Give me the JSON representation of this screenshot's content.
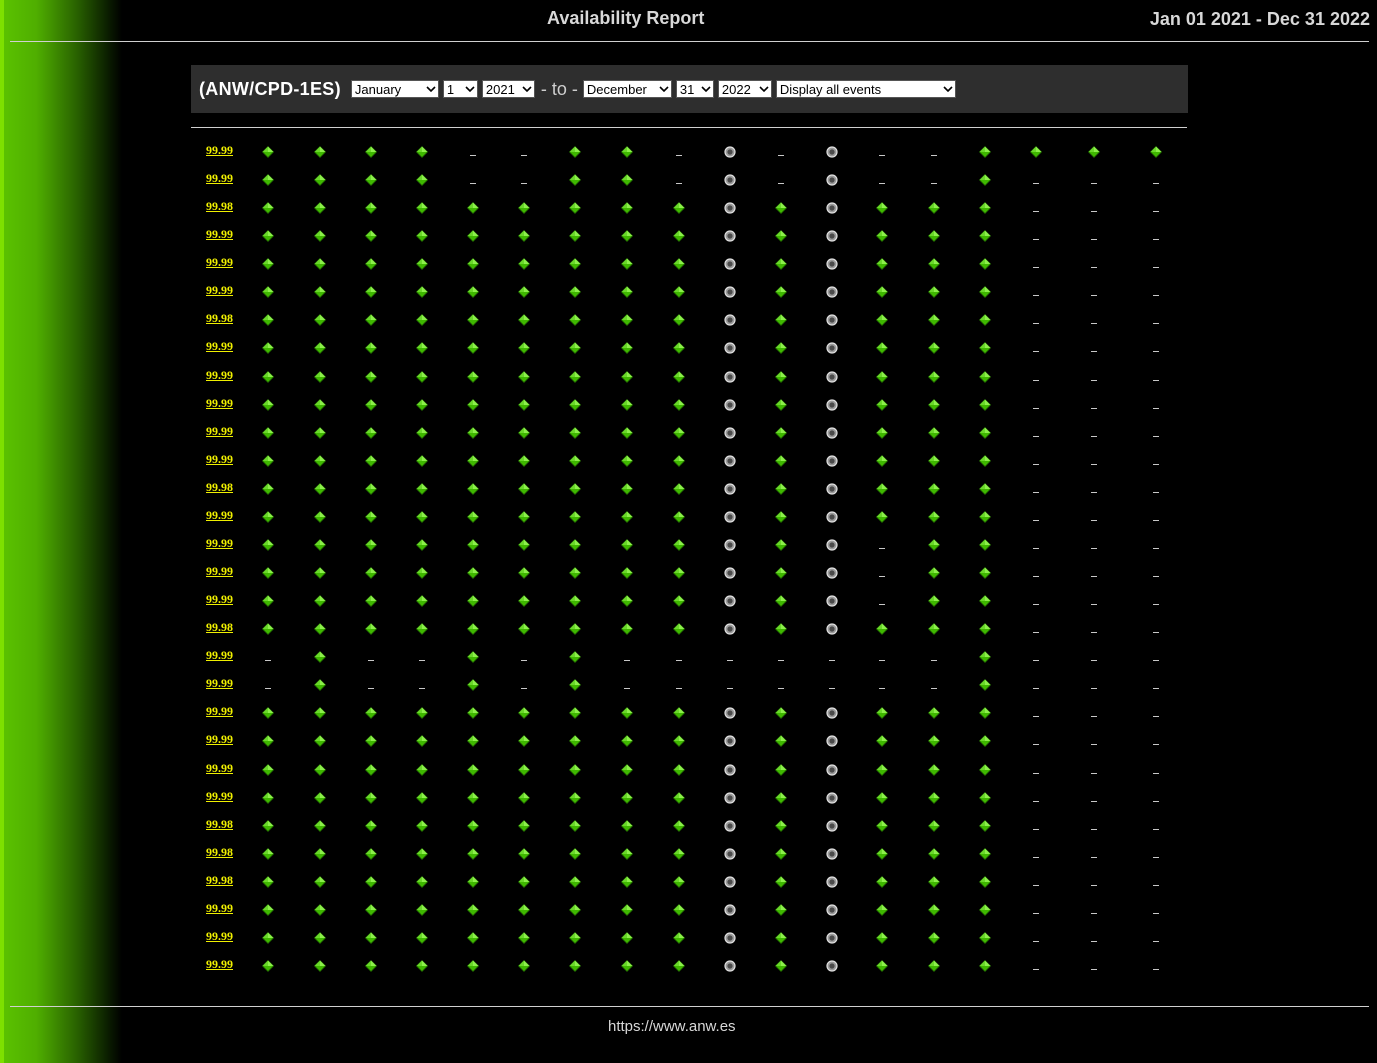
{
  "header": {
    "title": "Availability Report",
    "date_range": "Jan 01 2021 - Dec 31 2022"
  },
  "controls": {
    "device": "(ANW/CPD-1ES)",
    "from_month": "January",
    "from_day": "1",
    "from_year": "2021",
    "separator": "- to -",
    "to_month": "December",
    "to_day": "31",
    "to_year": "2022",
    "event_filter": "Display all events"
  },
  "icons": {
    "ok": "green-diamond-icon",
    "none": "grey-circle-icon",
    "empty": "dash"
  },
  "rows": [
    {
      "availability": "99.99",
      "cells": "GGGG--GG-N-N--GGGG"
    },
    {
      "availability": "99.99",
      "cells": "GGGG--GG-N-N--G---"
    },
    {
      "availability": "99.98",
      "cells": "GGGGGGGGGNGNGGG---"
    },
    {
      "availability": "99.99",
      "cells": "GGGGGGGGGNGNGGG---"
    },
    {
      "availability": "99.99",
      "cells": "GGGGGGGGGNGNGGG---"
    },
    {
      "availability": "99.99",
      "cells": "GGGGGGGGGNGNGGG---"
    },
    {
      "availability": "99.98",
      "cells": "GGGGGGGGGNGNGGG---"
    },
    {
      "availability": "99.99",
      "cells": "GGGGGGGGGNGNGGG---"
    },
    {
      "availability": "99.99",
      "cells": "GGGGGGGGGNGNGGG---"
    },
    {
      "availability": "99.99",
      "cells": "GGGGGGGGGNGNGGG---"
    },
    {
      "availability": "99.99",
      "cells": "GGGGGGGGGNGNGGG---"
    },
    {
      "availability": "99.99",
      "cells": "GGGGGGGGGNGNGGG---"
    },
    {
      "availability": "99.98",
      "cells": "GGGGGGGGGNGNGGG---"
    },
    {
      "availability": "99.99",
      "cells": "GGGGGGGGGNGNGGG---"
    },
    {
      "availability": "99.99",
      "cells": "GGGGGGGGGNGN-GG---"
    },
    {
      "availability": "99.99",
      "cells": "GGGGGGGGGNGN-GG---"
    },
    {
      "availability": "99.99",
      "cells": "GGGGGGGGGNGN-GG---"
    },
    {
      "availability": "99.98",
      "cells": "GGGGGGGGGNGNGGG---"
    },
    {
      "availability": "99.99",
      "cells": "-G--G-G-------G---"
    },
    {
      "availability": "99.99",
      "cells": "-G--G-G-------G---"
    },
    {
      "availability": "99.99",
      "cells": "GGGGGGGGGNGNGGG---"
    },
    {
      "availability": "99.99",
      "cells": "GGGGGGGGGNGNGGG---"
    },
    {
      "availability": "99.99",
      "cells": "GGGGGGGGGNGNGGG---"
    },
    {
      "availability": "99.99",
      "cells": "GGGGGGGGGNGNGGG---"
    },
    {
      "availability": "99.98",
      "cells": "GGGGGGGGGNGNGGG---"
    },
    {
      "availability": "99.98",
      "cells": "GGGGGGGGGNGNGGG---"
    },
    {
      "availability": "99.98",
      "cells": "GGGGGGGGGNGNGGG---"
    },
    {
      "availability": "99.99",
      "cells": "GGGGGGGGGNGNGGG---"
    },
    {
      "availability": "99.99",
      "cells": "GGGGGGGGGNGNGGG---"
    },
    {
      "availability": "99.99",
      "cells": "GGGGGGGGGNGNGGG---"
    }
  ],
  "footer": {
    "url": "https://www.anw.es"
  }
}
